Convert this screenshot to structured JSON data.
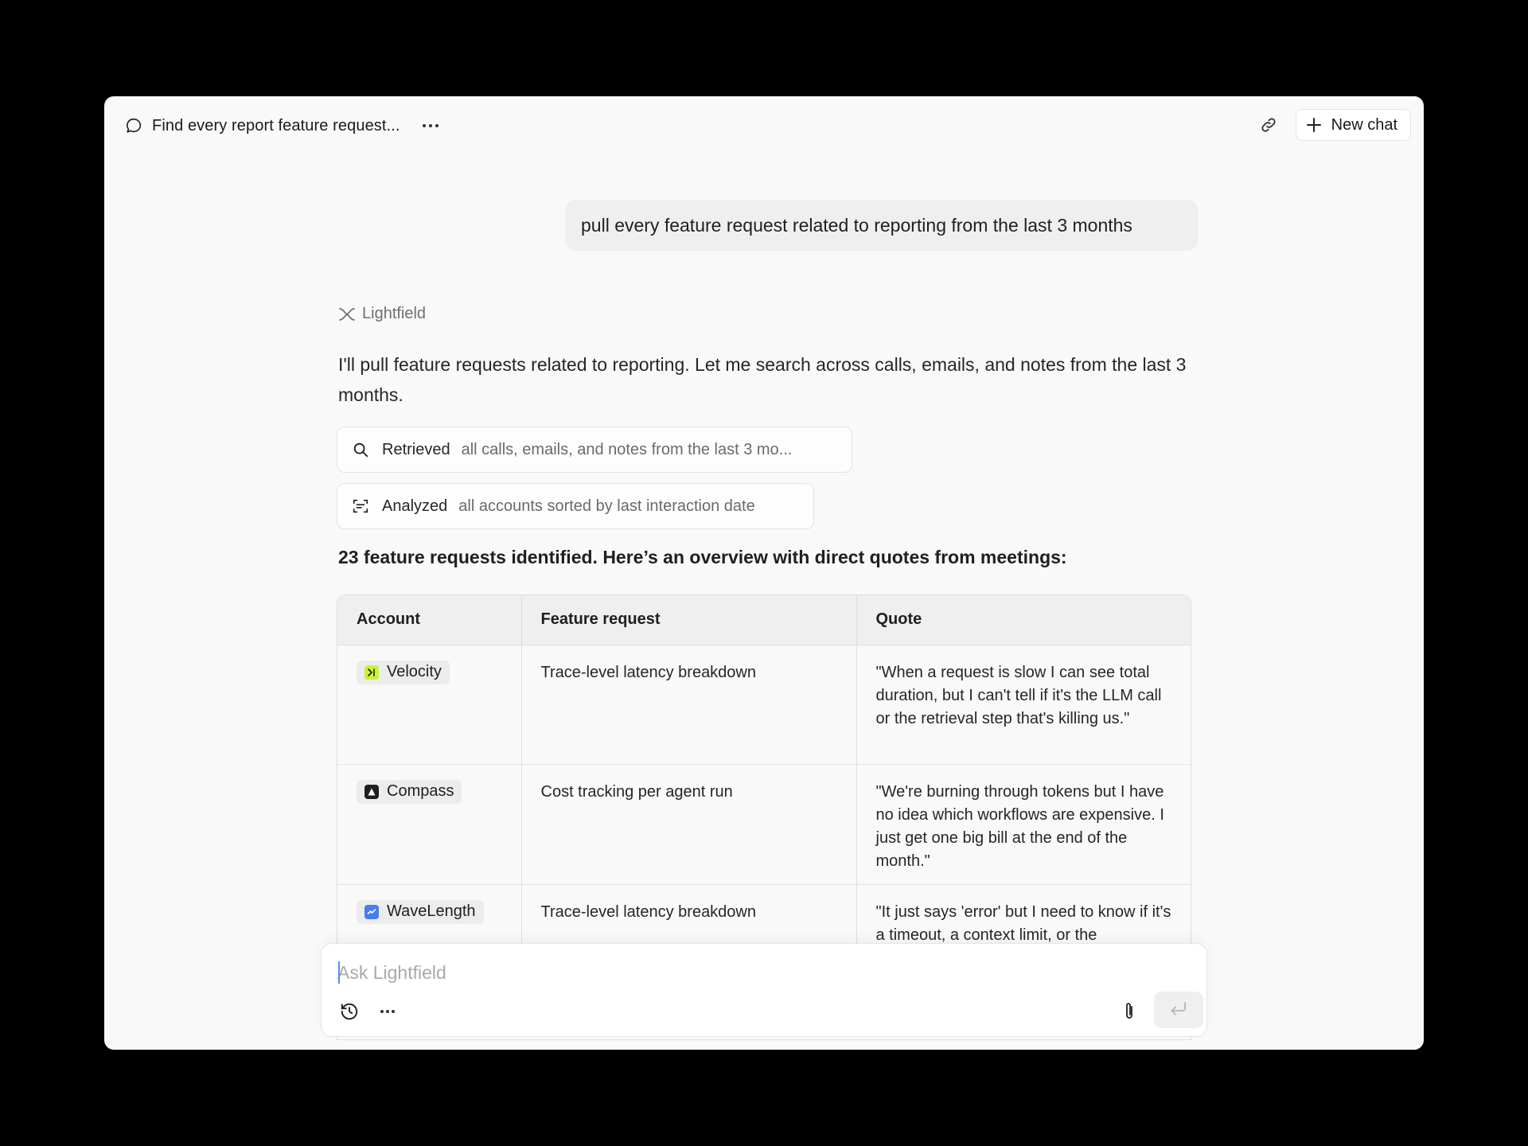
{
  "header": {
    "chat_title": "Find every report feature request...",
    "more_icon": "ellipsis-icon",
    "link_icon": "link-icon",
    "new_chat_label": "New chat"
  },
  "conversation": {
    "user_message": "pull every feature request related to reporting from the last 3 months",
    "assistant_name": "Lightfield",
    "assistant_intro": "I'll pull feature requests related to reporting. Let me search across calls, emails, and notes from the last 3 months.",
    "tool_steps": [
      {
        "icon": "search-icon",
        "verb": "Retrieved",
        "detail": "all calls, emails, and notes from the last 3 mo..."
      },
      {
        "icon": "scan-icon",
        "verb": "Analyzed",
        "detail": "all accounts sorted by last interaction date"
      }
    ],
    "summary": "23 feature requests identified. Here’s an overview with direct quotes from meetings:"
  },
  "table": {
    "headers": [
      "Account",
      "Feature request",
      "Quote"
    ],
    "rows": [
      {
        "account": "Velocity",
        "logo_color": "#c6f432",
        "feature": "Trace-level latency breakdown",
        "quote": "\"When a request is slow I can see total duration, but I can't tell if it's the LLM call or the retrieval step that's killing us.\""
      },
      {
        "account": "Compass",
        "logo_color": "#1f1f1f",
        "feature": "Cost tracking per agent run",
        "quote": "\"We're burning through tokens but I have no idea which workflows are expensive. I just get one big bill at the end of the month.\""
      },
      {
        "account": "WaveLength",
        "logo_color": "#4a7cf0",
        "feature": "Trace-level latency breakdown",
        "quote": "\"It just says 'error' but I need to know if it's a timeout, a context limit, or the"
      }
    ]
  },
  "composer": {
    "placeholder": "Ask Lightfield",
    "history_icon": "history-icon",
    "more_icon": "ellipsis-icon",
    "attach_icon": "paperclip-icon",
    "send_icon": "enter-icon"
  }
}
